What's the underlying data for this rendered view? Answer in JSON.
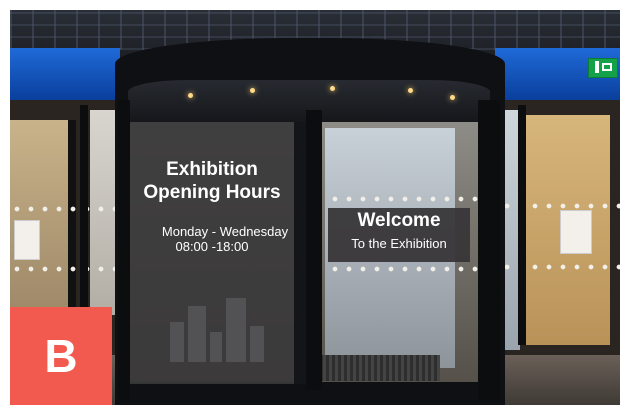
{
  "sign": {
    "title_line1": "Exhibition",
    "title_line2": "Opening Hours",
    "days": "Monday - Wednesday",
    "hours": "08:00 -18:00"
  },
  "banner": {
    "title": "Welcome",
    "subtitle": "To the Exhibition"
  },
  "badge": {
    "label": "B",
    "color": "#f25a50"
  },
  "icons": [
    "exit-sign-icon"
  ]
}
